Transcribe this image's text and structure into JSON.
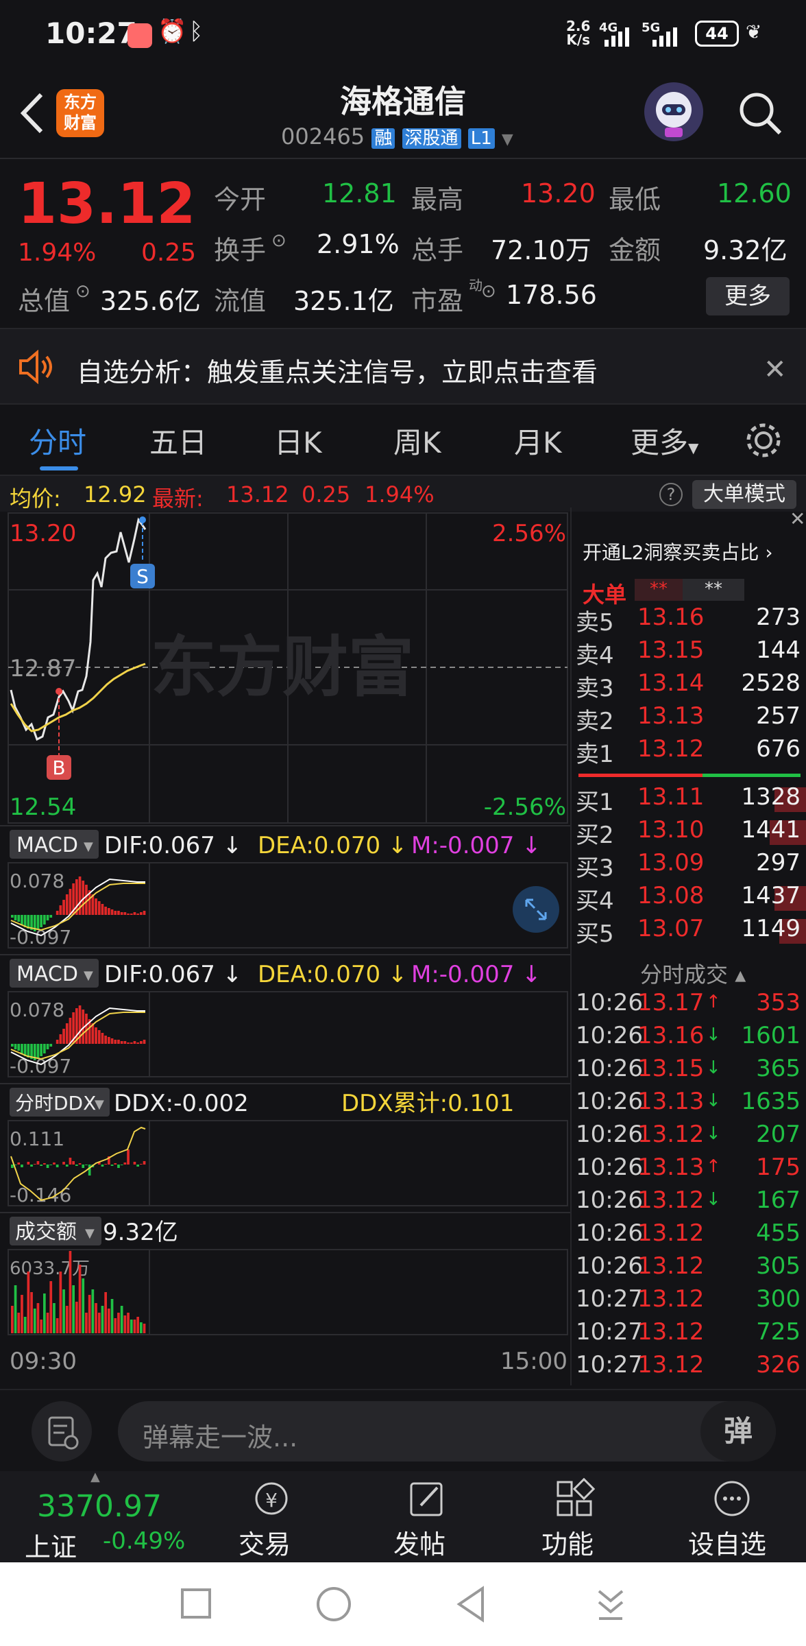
{
  "status": {
    "time": "10:27",
    "net_speed_top": "2.6",
    "net_speed_bottom": "K/s",
    "signal1": "4G",
    "signal2": "5G",
    "battery": "44"
  },
  "header": {
    "back": "back",
    "logo_line1": "东方",
    "logo_line2": "财富",
    "title": "海格通信",
    "code": "002465",
    "badge_rong": "融",
    "badge_sgt": "深股通",
    "badge_l1": "L1"
  },
  "quote": {
    "price": "13.12",
    "change_pct": "1.94%",
    "change": "0.25",
    "open_label": "今开",
    "open": "12.81",
    "high_label": "最高",
    "high": "13.20",
    "low_label": "最低",
    "low": "12.60",
    "turnover_label": "换手",
    "turnover": "2.91%",
    "volume_label": "总手",
    "volume": "72.10万",
    "amount_label": "金额",
    "amount": "9.32亿",
    "mcap_label": "总值",
    "mcap": "325.6亿",
    "float_label": "流值",
    "float": "325.1亿",
    "pe_label": "市盈",
    "pe_sup": "动",
    "pe": "178.56",
    "more": "更多"
  },
  "notice": {
    "text": "自选分析：触发重点关注信号，立即点击查看"
  },
  "tabs": [
    "分时",
    "五日",
    "日K",
    "周K",
    "月K",
    "更多"
  ],
  "avg_bar": {
    "avg_label": "均价:",
    "avg": "12.92",
    "latest_label": "最新:",
    "latest": "13.12",
    "chg": "0.25",
    "pct": "1.94%",
    "mode": "大单模式"
  },
  "main_chart": {
    "top_price": "13.20",
    "top_pct": "2.56%",
    "mid_price": "12.87",
    "bottom_price": "12.54",
    "bottom_pct": "-2.56%",
    "watermark": "东方财富",
    "marker_s": "S",
    "marker_b": "B",
    "time_start": "09:30",
    "time_end": "15:00"
  },
  "macd1": {
    "label": "MACD",
    "dif": "DIF:0.067",
    "dea": "DEA:0.070",
    "m": "M:-0.007",
    "top": "0.078",
    "bottom": "-0.097"
  },
  "macd2": {
    "label": "MACD",
    "dif": "DIF:0.067",
    "dea": "DEA:0.070",
    "m": "M:-0.007",
    "top": "0.078",
    "bottom": "-0.097"
  },
  "ddx": {
    "label": "分时DDX",
    "ddx": "DDX:-0.002",
    "cum": "DDX累计:0.101",
    "top": "0.111",
    "bottom": "-0.146"
  },
  "amount_panel": {
    "label": "成交额",
    "value": "9.32亿",
    "top": "6033.7万"
  },
  "book": {
    "l2_link": "开通L2洞察买卖占比",
    "big_order": "大单",
    "stars1": "**",
    "stars2": "**",
    "asks": [
      {
        "label": "卖5",
        "price": "13.16",
        "vol": "273"
      },
      {
        "label": "卖4",
        "price": "13.15",
        "vol": "144"
      },
      {
        "label": "卖3",
        "price": "13.14",
        "vol": "2528"
      },
      {
        "label": "卖2",
        "price": "13.13",
        "vol": "257"
      },
      {
        "label": "卖1",
        "price": "13.12",
        "vol": "676"
      }
    ],
    "bids": [
      {
        "label": "买1",
        "price": "13.11",
        "vol": "1328"
      },
      {
        "label": "买2",
        "price": "13.10",
        "vol": "1441"
      },
      {
        "label": "买3",
        "price": "13.09",
        "vol": "297"
      },
      {
        "label": "买4",
        "price": "13.08",
        "vol": "1437"
      },
      {
        "label": "买5",
        "price": "13.07",
        "vol": "1149"
      }
    ],
    "trades_title": "分时成交",
    "trades": [
      {
        "time": "10:26",
        "price": "13.17",
        "arrow": "↑",
        "vol": "353",
        "dir": "up"
      },
      {
        "time": "10:26",
        "price": "13.16",
        "arrow": "↓",
        "vol": "1601",
        "dir": "down"
      },
      {
        "time": "10:26",
        "price": "13.15",
        "arrow": "↓",
        "vol": "365",
        "dir": "down"
      },
      {
        "time": "10:26",
        "price": "13.13",
        "arrow": "↓",
        "vol": "1635",
        "dir": "down"
      },
      {
        "time": "10:26",
        "price": "13.12",
        "arrow": "↓",
        "vol": "207",
        "dir": "down"
      },
      {
        "time": "10:26",
        "price": "13.13",
        "arrow": "↑",
        "vol": "175",
        "dir": "up"
      },
      {
        "time": "10:26",
        "price": "13.12",
        "arrow": "↓",
        "vol": "167",
        "dir": "down"
      },
      {
        "time": "10:26",
        "price": "13.12",
        "arrow": "",
        "vol": "455",
        "dir": "down"
      },
      {
        "time": "10:26",
        "price": "13.12",
        "arrow": "",
        "vol": "305",
        "dir": "down"
      },
      {
        "time": "10:27",
        "price": "13.12",
        "arrow": "",
        "vol": "300",
        "dir": "down"
      },
      {
        "time": "10:27",
        "price": "13.12",
        "arrow": "",
        "vol": "725",
        "dir": "down"
      },
      {
        "time": "10:27",
        "price": "13.12",
        "arrow": "",
        "vol": "326",
        "dir": "up"
      }
    ]
  },
  "danmu": {
    "placeholder": "弹幕走一波...",
    "btn": "弹"
  },
  "bottomnav": {
    "index_value": "3370.97",
    "index_name": "上证",
    "index_pct": "-0.49%",
    "trade": "交易",
    "post": "发帖",
    "func": "功能",
    "watch": "设自选"
  }
}
